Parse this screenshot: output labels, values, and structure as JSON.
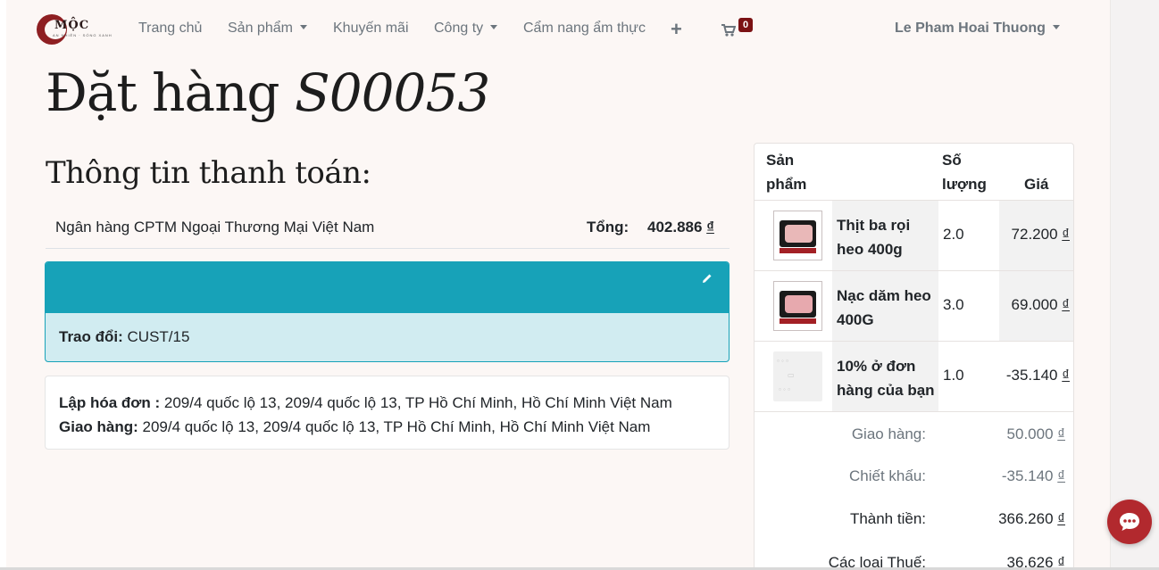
{
  "colors": {
    "accent_teal": "#17a2b8",
    "brand_red": "#8e1f22",
    "background": "#fcf7f5"
  },
  "logo": {
    "brand": "MỘC",
    "tagline": "AN NHIÊN · SỐNG XANH",
    "icon": "moc-logo"
  },
  "nav": {
    "home": "Trang chủ",
    "products": "Sản phẩm",
    "promotions": "Khuyến mãi",
    "company": "Công ty",
    "guide": "Cẩm nang ẩm thực",
    "add_icon": "plus-icon",
    "cart_icon": "shopping-cart-icon",
    "cart_count": "0",
    "user": "Le Pham Hoai Thuong"
  },
  "page": {
    "title": "Đặt hàng",
    "order_ref": "S00053",
    "payment_heading": "Thông tin thanh toán:"
  },
  "payment": {
    "bank": "Ngân hàng CPTM Ngoại Thương Mại Việt Nam",
    "total_label": "Tổng:",
    "total_value": "402.886",
    "currency": "₫"
  },
  "exchange": {
    "label": "Trao đổi:",
    "value": "CUST/15",
    "edit_icon": "pencil-icon"
  },
  "addresses": {
    "billing_label": "Lập hóa đơn :",
    "billing_value": "209/4 quốc lộ 13, 209/4 quốc lộ 13, TP Hồ Chí Minh, Hồ Chí Minh Việt Nam",
    "shipping_label": "Giao hàng:",
    "shipping_value": "209/4 quốc lộ 13, 209/4 quốc lộ 13, TP Hồ Chí Minh, Hồ Chí Minh Việt Nam"
  },
  "order_table": {
    "headers": {
      "product": "Sản phẩm",
      "quantity": "Số lượng",
      "price": "Giá"
    },
    "rows": [
      {
        "name": "Thịt ba rọi heo 400g",
        "qty": "2.0",
        "price": "72.200",
        "currency": "₫"
      },
      {
        "name": "Nạc dăm heo 400G",
        "qty": "3.0",
        "price": "69.000",
        "currency": "₫"
      },
      {
        "name": "10% ở đơn hàng của bạn",
        "qty": "1.0",
        "price": "-35.140",
        "currency": "₫"
      }
    ],
    "summary": [
      {
        "label": "Giao hàng:",
        "value": "50.000",
        "currency": "₫"
      },
      {
        "label": "Chiết khấu:",
        "value": "-35.140",
        "currency": "₫"
      },
      {
        "label": "Thành tiền:",
        "value": "366.260",
        "currency": "₫"
      },
      {
        "label": "Các loại Thuế:",
        "value": "36.626",
        "currency": "₫"
      }
    ]
  },
  "chat": {
    "icon": "chat-bubble-icon"
  }
}
